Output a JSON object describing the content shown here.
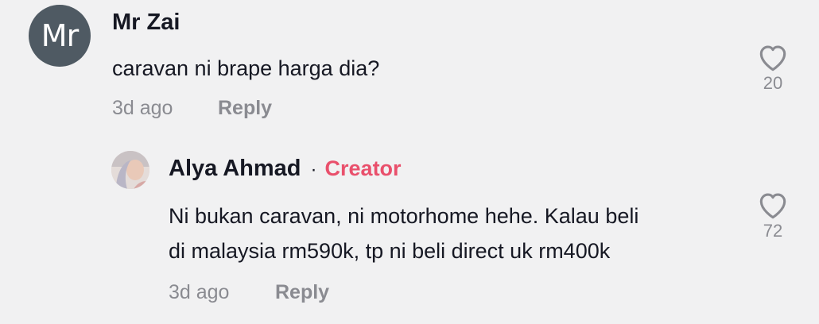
{
  "comment": {
    "avatar_initials": "Mr",
    "username": "Mr Zai",
    "text": "caravan ni brape harga dia?",
    "timestamp": "3d ago",
    "reply_label": "Reply",
    "like_count": "20",
    "like_icon": "heart-outline-icon"
  },
  "reply": {
    "username": "Alya Ahmad",
    "separator": "·",
    "badge": "Creator",
    "text_line1": "Ni bukan caravan, ni motorhome hehe. Kalau beli",
    "text_line2": "di malaysia rm590k, tp ni beli direct uk rm400k",
    "timestamp": "3d ago",
    "reply_label": "Reply",
    "like_count": "72",
    "like_icon": "heart-outline-icon"
  },
  "colors": {
    "background": "#f1f1f2",
    "text_primary": "#161823",
    "text_secondary": "#8a8b91",
    "avatar_bg": "#4f5a63",
    "creator_badge": "#e9506c"
  }
}
